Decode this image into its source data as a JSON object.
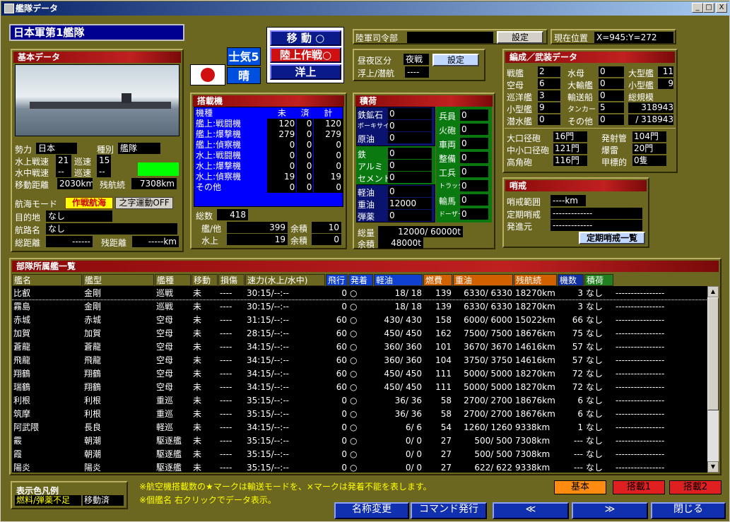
{
  "window": {
    "title": "艦隊データ",
    "min": "_",
    "max": "□",
    "close": "X"
  },
  "fleet_name": "日本軍第1艦隊",
  "mode_buttons": [
    "移 動 ○",
    "陸上作戦○",
    "洋上"
  ],
  "morale_label": "士気5",
  "weather_label": "晴",
  "army_hq": {
    "label": "陸軍司令部",
    "value": "",
    "btn": "設定"
  },
  "position": {
    "label": "現在位置",
    "value": "X=945:Y=272"
  },
  "daynight": {
    "label": "昼夜区分",
    "value": "夜戦",
    "btn": "設定",
    "sub_label": "浮上/潜航",
    "sub_value": "----"
  },
  "basic": {
    "title": "基本データ",
    "rows": [
      {
        "k": "勢力",
        "v": "日本",
        "k2": "種別",
        "v2": "艦隊"
      },
      {
        "k": "水上戦速",
        "v": "21",
        "k2": "巡速",
        "v2": "15"
      },
      {
        "k": "水中戦速",
        "v": "--",
        "k2": "巡速",
        "v2": "--"
      },
      {
        "k": "移動距離",
        "v": "2030km",
        "k2": "残航続",
        "v2": "7308km"
      }
    ],
    "nav_label": "航海モード",
    "nav_mode": "作戦航海",
    "nav_mode2": "之字運動OFF",
    "dest_label": "目的地",
    "dest": "なし",
    "route_label": "航路名",
    "route": "なし",
    "dist_label": "総距離",
    "dist": "------",
    "rem_label": "残距離",
    "rem": "-----km"
  },
  "aircraft": {
    "title": "搭載機",
    "cols": [
      "機種",
      "未",
      "済",
      "計"
    ],
    "rows": [
      [
        "艦上:戦闘機",
        "120",
        "0",
        "120"
      ],
      [
        "艦上:爆撃機",
        "279",
        "0",
        "279"
      ],
      [
        "艦上:偵察機",
        "0",
        "0",
        "0"
      ],
      [
        "水上:戦闘機",
        "0",
        "0",
        "0"
      ],
      [
        "水上:爆撃機",
        "0",
        "0",
        "0"
      ],
      [
        "水上:偵察機",
        "19",
        "0",
        "19"
      ],
      [
        "その他",
        "0",
        "0",
        "0"
      ]
    ],
    "total_label": "総数",
    "total": "418",
    "ship_label": "艦/他",
    "ship": "399",
    "spare_label": "余積",
    "spare": "10",
    "water_label": "水上",
    "water": "19",
    "spare2_label": "余積",
    "spare2": "0"
  },
  "cargo": {
    "title": "積荷",
    "left": [
      [
        "鉄鉱石",
        "0"
      ],
      [
        "ボーキサイト",
        "0"
      ],
      [
        "原油",
        "0"
      ],
      [
        "鉄",
        "0"
      ],
      [
        "アルミ",
        "0"
      ],
      [
        "セメント",
        "0"
      ],
      [
        "軽油",
        "0"
      ],
      [
        "重油",
        "12000"
      ],
      [
        "弾薬",
        "0"
      ]
    ],
    "right": [
      [
        "兵員",
        "0"
      ],
      [
        "火砲",
        "0"
      ],
      [
        "車両",
        "0"
      ],
      [
        "整備",
        "0"
      ],
      [
        "工兵",
        "0"
      ],
      [
        "トラック",
        "0"
      ],
      [
        "輸馬",
        "0"
      ],
      [
        "ドーザー",
        "0"
      ]
    ],
    "total_label": "総量",
    "total": "12000/  60000t",
    "spare_label": "余積",
    "spare": "48000t"
  },
  "composition": {
    "title": "編成／武装データ",
    "rows": [
      [
        "戦艦",
        "2",
        "水母",
        "0",
        "大型艦",
        "11"
      ],
      [
        "空母",
        "6",
        "大輸艦",
        "0",
        "小型艦",
        "9"
      ],
      [
        "巡洋艦",
        "3",
        "輸送船",
        "0",
        "総規模",
        ""
      ],
      [
        "小型艦",
        "9",
        "タンカー",
        "5",
        "",
        "318943"
      ],
      [
        "潜水艦",
        "0",
        "その他",
        "0",
        "",
        "/ 318943"
      ]
    ],
    "arm": [
      [
        "大口径砲",
        "16門",
        "発射管",
        "104門"
      ],
      [
        "中小口径砲",
        "121門",
        "爆雷",
        "20門"
      ],
      [
        "高角砲",
        "116門",
        "甲標的",
        "0隻"
      ]
    ]
  },
  "patrol": {
    "title": "哨戒",
    "range_label": "哨戒範囲",
    "range": "----km",
    "reg_label": "定期哨戒",
    "reg": "-------------",
    "start_label": "発進元",
    "start": "-------------",
    "btn": "定期哨戒一覧"
  },
  "list": {
    "title": "部隊所属艦一覧",
    "cols": [
      "艦名",
      "艦型",
      "艦種",
      "移動",
      "損傷",
      "速力(水上/水中)",
      "飛行",
      "発着",
      "軽油",
      "燃費",
      "重油",
      "残航続",
      "機数",
      "積荷"
    ],
    "rows": [
      [
        "比叡",
        "金剛",
        "巡戦",
        "未",
        "----",
        "30:15/--:--",
        "0",
        "○",
        "18/  18",
        "139",
        "6330/ 6330",
        "18270km",
        "3",
        "なし"
      ],
      [
        "霧島",
        "金剛",
        "巡戦",
        "未",
        "----",
        "30:15/--:--",
        "0",
        "○",
        "18/  18",
        "139",
        "6330/ 6330",
        "18270km",
        "3",
        "なし"
      ],
      [
        "赤城",
        "赤城",
        "空母",
        "未",
        "----",
        "31:15/--:--",
        "60",
        "○",
        "430/ 430",
        "158",
        "6000/ 6000",
        "15022km",
        "66",
        "なし"
      ],
      [
        "加賀",
        "加賀",
        "空母",
        "未",
        "----",
        "28:15/--:--",
        "60",
        "○",
        "450/ 450",
        "162",
        "7500/ 7500",
        "18676km",
        "75",
        "なし"
      ],
      [
        "蒼龍",
        "蒼龍",
        "空母",
        "未",
        "----",
        "34:15/--:--",
        "60",
        "○",
        "360/ 360",
        "101",
        "3670/ 3670",
        "14616km",
        "57",
        "なし"
      ],
      [
        "飛龍",
        "飛龍",
        "空母",
        "未",
        "----",
        "34:15/--:--",
        "60",
        "○",
        "360/ 360",
        "104",
        "3750/ 3750",
        "14616km",
        "57",
        "なし"
      ],
      [
        "翔鶴",
        "翔鶴",
        "空母",
        "未",
        "----",
        "34:15/--:--",
        "60",
        "○",
        "450/ 450",
        "111",
        "5000/ 5000",
        "18270km",
        "72",
        "なし"
      ],
      [
        "瑞鶴",
        "翔鶴",
        "空母",
        "未",
        "----",
        "34:15/--:--",
        "60",
        "○",
        "450/ 450",
        "111",
        "5000/ 5000",
        "18270km",
        "72",
        "なし"
      ],
      [
        "利根",
        "利根",
        "重巡",
        "未",
        "----",
        "35:15/--:--",
        "0",
        "○",
        "36/  36",
        "58",
        "2700/ 2700",
        "18676km",
        "6",
        "なし"
      ],
      [
        "筑摩",
        "利根",
        "重巡",
        "未",
        "----",
        "35:15/--:--",
        "0",
        "○",
        "36/  36",
        "58",
        "2700/ 2700",
        "18676km",
        "6",
        "なし"
      ],
      [
        "阿武隈",
        "長良",
        "軽巡",
        "未",
        "----",
        "34:15/--:--",
        "0",
        "○",
        "6/   6",
        "54",
        "1260/ 1260",
        "9338km",
        "1",
        "なし"
      ],
      [
        "霰",
        "朝潮",
        "駆逐艦",
        "未",
        "----",
        "35:15/--:--",
        "0",
        "○",
        "0/   0",
        "27",
        "500/  500",
        "7308km",
        "---",
        "なし"
      ],
      [
        "霞",
        "朝潮",
        "駆逐艦",
        "未",
        "----",
        "35:15/--:--",
        "0",
        "○",
        "0/   0",
        "27",
        "500/  500",
        "7308km",
        "---",
        "なし"
      ],
      [
        "陽炎",
        "陽炎",
        "駆逐艦",
        "未",
        "----",
        "35:15/--:--",
        "0",
        "○",
        "0/   0",
        "27",
        "622/  622",
        "9338km",
        "---",
        "なし"
      ]
    ],
    "dash": "----------------"
  },
  "legend": {
    "title": "表示色凡例",
    "a": "燃料/弾薬不足",
    "b": "移動済"
  },
  "notes": [
    "※航空機搭載数の★マークは輸送モードを、×マークは発着不能を表します。",
    "※個艦名 右クリックでデータ表示。"
  ],
  "tabs": [
    "基本",
    "搭載1",
    "搭載2"
  ],
  "bottom": [
    "名称変更",
    "コマンド発行",
    "≪",
    "≫",
    "閉じる"
  ]
}
